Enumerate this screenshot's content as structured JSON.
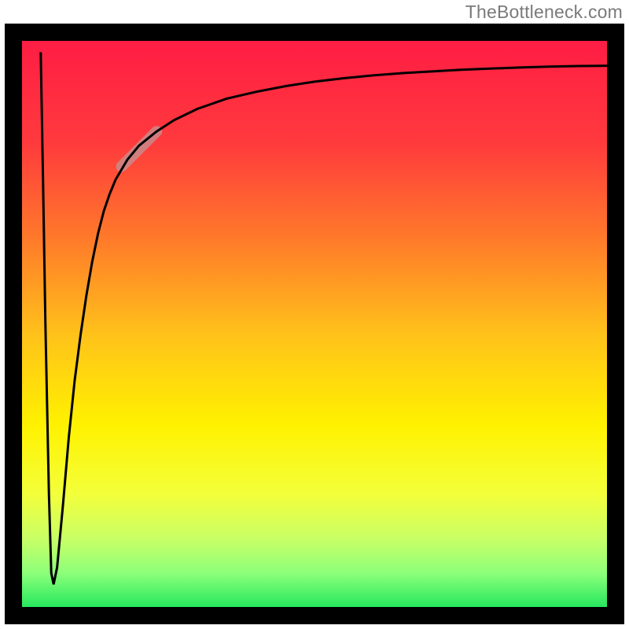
{
  "watermark": {
    "text": "TheBottleneck.com"
  },
  "chart_data": {
    "type": "line",
    "title": "",
    "xlabel": "",
    "ylabel": "",
    "xlim": [
      0,
      100
    ],
    "ylim": [
      0,
      100
    ],
    "grid": false,
    "series": [
      {
        "name": "bottleneck-curve",
        "x": [
          3.2,
          3.6,
          4.0,
          4.6,
          5.0,
          5.4,
          6.0,
          7.0,
          8.0,
          9.0,
          10,
          11,
          12,
          13,
          14,
          15,
          16,
          18,
          20,
          23,
          26,
          30,
          35,
          40,
          45,
          50,
          55,
          60,
          65,
          70,
          75,
          80,
          85,
          90,
          95,
          100
        ],
        "y": [
          98,
          75,
          50,
          20,
          6,
          4,
          7,
          18,
          30,
          40,
          48,
          55,
          61,
          66,
          70,
          73,
          75.5,
          79,
          81.5,
          84,
          86,
          88,
          89.8,
          91,
          92,
          92.8,
          93.4,
          93.9,
          94.3,
          94.6,
          94.9,
          95.1,
          95.3,
          95.45,
          95.55,
          95.6
        ]
      }
    ],
    "highlight": {
      "name": "highlight-segment",
      "x": [
        17,
        23
      ],
      "y": [
        77.8,
        84
      ]
    },
    "background_gradient": {
      "stops": [
        {
          "offset": 0.0,
          "color": "#ff1d44"
        },
        {
          "offset": 0.18,
          "color": "#ff3a3d"
        },
        {
          "offset": 0.35,
          "color": "#ff7a2a"
        },
        {
          "offset": 0.52,
          "color": "#ffc21a"
        },
        {
          "offset": 0.68,
          "color": "#fff200"
        },
        {
          "offset": 0.8,
          "color": "#f3ff3a"
        },
        {
          "offset": 0.88,
          "color": "#c8ff66"
        },
        {
          "offset": 0.94,
          "color": "#8dff7a"
        },
        {
          "offset": 1.0,
          "color": "#26e85e"
        }
      ]
    },
    "frame_thickness_px": 22,
    "highlight_color": "#c98a8a"
  }
}
